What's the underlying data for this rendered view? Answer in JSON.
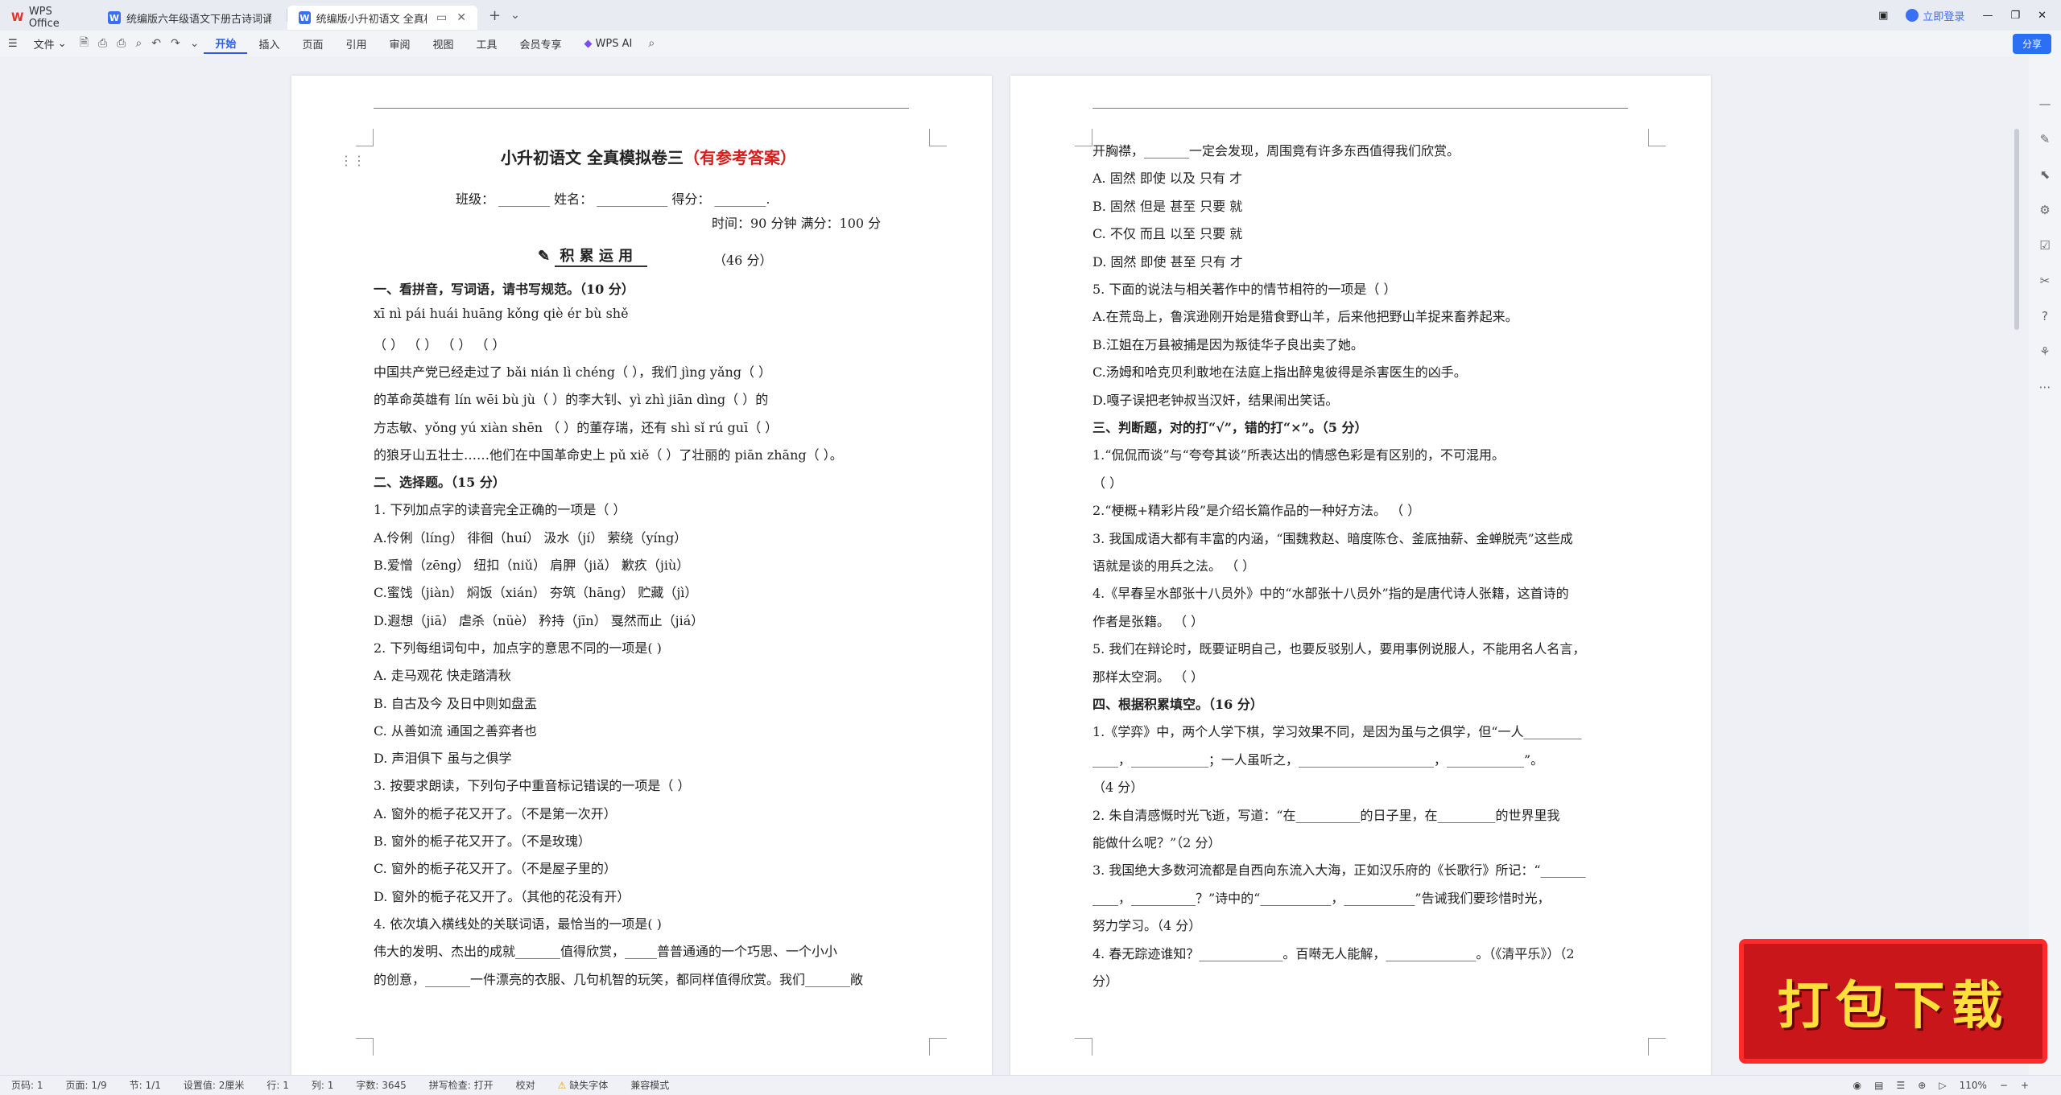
{
  "tabs": [
    {
      "label": "WPS Office",
      "icon": "wps-logo-icon"
    },
    {
      "label": "统编版六年级语文下册古诗词诵读测",
      "icon": "word-doc-icon"
    },
    {
      "label": "统编版小升初语文 全真模拟卷",
      "icon": "word-doc-icon"
    }
  ],
  "topright": {
    "login": "立即登录"
  },
  "toolbar": {
    "file": "文件",
    "menus": [
      "开始",
      "插入",
      "页面",
      "引用",
      "审阅",
      "视图",
      "工具",
      "会员专享"
    ],
    "wpsai": "WPS AI",
    "share": "分享"
  },
  "page1": {
    "title_main": "小升初语文 全真模拟卷三",
    "title_red": "（有参考答案）",
    "info": "班级： ________   姓名： ___________   得分： ________.",
    "time": "时间：90 分钟    满分：100 分",
    "section": "积 累 运 用",
    "section_score": "（46 分）",
    "lines": [
      {
        "t": "一、看拼音，写词语，请书写规范。（10 分）",
        "b": true
      },
      {
        "t": "   xī  nì           pái  huái        huāng  kǒng       qiè  ér  bù  shě"
      },
      {
        "t": "（         ）    （         ）    （         ）     （                 ）"
      },
      {
        "t": "      中国共产党已经走过了 bǎi  nián  lì  chéng（             ），我们 jìng  yǎng（        ）"
      },
      {
        "t": "的革命英雄有 lín  wēi  bù  jù（             ）的李大钊、yì  zhì  jiān  dìng（            ）的"
      },
      {
        "t": "方志敏、yǒng  yú  xiàn  shēn （            ）的董存瑞，还有 shì  sǐ  rú  guī（             ）"
      },
      {
        "t": "的狼牙山五壮士……他们在中国革命史上 pǔ  xiě（        ）了壮丽的 piān   zhāng（         ）。"
      },
      {
        "t": "二、选择题。（15 分）",
        "b": true
      },
      {
        "t": "1. 下列加点字的读音完全正确的一项是（          ）"
      },
      {
        "t": "   A.伶俐（líng）   徘徊（huí）      汲水（jí）         萦绕（yíng）"
      },
      {
        "t": "   B.爱憎（zēng）   纽扣（niǔ）      肩胛（jiǎ）        歉疚（jiù）"
      },
      {
        "t": "   C.蜜饯（jiàn）   焖饭（xián）     夯筑（hāng）       贮藏（jì）"
      },
      {
        "t": "   D.遐想（jiā）    虐杀（nüè）      矜持（jīn）        戛然而止（jiá）"
      },
      {
        "t": "2. 下列每组词句中，加点字的意思不同的一项是(       )"
      },
      {
        "t": "   A. 走马观花                    快走踏清秋"
      },
      {
        "t": "   B. 自古及今                    及日中则如盘盂"
      },
      {
        "t": "   C. 从善如流                    通国之善弈者也"
      },
      {
        "t": "   D. 声泪俱下                    虽与之俱学"
      },
      {
        "t": "3. 按要求朗读，下列句子中重音标记错误的一项是（          ）"
      },
      {
        "t": "   A. 窗外的栀子花又开了。（不是第一次开）"
      },
      {
        "t": "   B. 窗外的栀子花又开了。（不是玫瑰）"
      },
      {
        "t": "   C. 窗外的栀子花又开了。（不是屋子里的）"
      },
      {
        "t": "   D. 窗外的栀子花又开了。（其他的花没有开）"
      },
      {
        "t": "4. 依次填入横线处的关联词语，最恰当的一项是(        )"
      },
      {
        "t": "      伟大的发明、杰出的成就_______值得欣赏，_____普普通通的一个巧思、一个小小"
      },
      {
        "t": "的创意，_______一件漂亮的衣服、几句机智的玩笑，都同样值得欣赏。我们_______敞"
      }
    ]
  },
  "page2": {
    "lines": [
      {
        "t": "开胸襟，_______一定会发现，周围竟有许多东西值得我们欣赏。"
      },
      {
        "t": "   A. 固然       即使       以及       只有       才"
      },
      {
        "t": "   B. 固然       但是       甚至       只要       就"
      },
      {
        "t": "   C. 不仅       而且       以至       只要       就"
      },
      {
        "t": "   D. 固然       即使       甚至       只有       才"
      },
      {
        "t": "5. 下面的说法与相关著作中的情节相符的一项是（          ）"
      },
      {
        "t": "   A.在荒岛上，鲁滨逊刚开始是猎食野山羊，后来他把野山羊捉来畜养起来。"
      },
      {
        "t": "   B.江姐在万县被捕是因为叛徒华子良出卖了她。"
      },
      {
        "t": "   C.汤姆和哈克贝利敢地在法庭上指出醉鬼彼得是杀害医生的凶手。"
      },
      {
        "t": "   D.嘎子误把老钟叔当汉奸，结果闹出笑话。"
      },
      {
        "t": "三、判断题，对的打“√”，错的打“×”。（5 分）",
        "b": true
      },
      {
        "t": "   1.“侃侃而谈”与“夸夸其谈”所表达出的情感色彩是有区别的，不可混用。"
      },
      {
        "t": "                                                                                               （              ）"
      },
      {
        "t": "   2.“梗概+精彩片段”是介绍长篇作品的一种好方法。                      （              ）"
      },
      {
        "t": "   3. 我国成语大都有丰富的内涵，“围魏救赵、暗度陈仓、釜底抽薪、金蝉脱壳”这些成"
      },
      {
        "t": "      语就是谈的用兵之法。                                                      （              ）"
      },
      {
        "t": "   4.《早春呈水部张十八员外》中的“水部张十八员外”指的是唐代诗人张籍，这首诗的"
      },
      {
        "t": "      作者是张籍。                                                                （              ）"
      },
      {
        "t": "   5. 我们在辩论时，既要证明自己，也要反驳别人，要用事例说服人，不能用名人名言，"
      },
      {
        "t": "      那样太空洞。                                                                （              ）"
      },
      {
        "t": "四、根据积累填空。（16 分）",
        "b": true
      },
      {
        "t": "1.《学弈》中，两个人学下棋，学习效果不同，是因为虽与之俱学，但“一人_________"
      },
      {
        "t": "____，____________；一人虽听之，_____________________，____________”。"
      },
      {
        "t": "   （4 分）"
      },
      {
        "t": "2. 朱自清感慨时光飞逝，写道：“在__________的日子里，在_________的世界里我"
      },
      {
        "t": "能做什么呢？”（2 分）"
      },
      {
        "t": "3. 我国绝大多数河流都是自西向东流入大海，正如汉乐府的《长歌行》所记：“_______"
      },
      {
        "t": "____，__________？”诗中的“___________，___________”告诫我们要珍惜时光，"
      },
      {
        "t": "努力学习。（4 分）"
      },
      {
        "t": "4. 春无踪迹谁知？_____________。百啭无人能解，______________。（《清平乐》）（2"
      },
      {
        "t": "分）"
      }
    ]
  },
  "status": {
    "items": [
      "页码: 1",
      "页面: 1/9",
      "节: 1/1",
      "设置值: 2厘米",
      "行: 1",
      "列: 1",
      "字数: 3645",
      "拼写检查: 打开",
      "校对",
      "缺失字体",
      "兼容模式"
    ],
    "zoom": "110%"
  },
  "banner": {
    "text": "打包下载"
  }
}
